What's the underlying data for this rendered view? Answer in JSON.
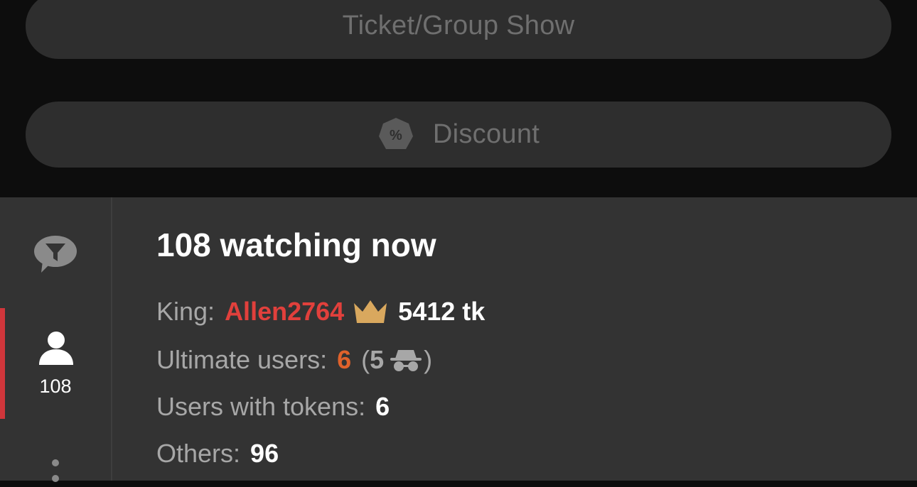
{
  "top_buttons": {
    "ticket_label": "Ticket/Group Show",
    "discount_label": "Discount"
  },
  "sidebar": {
    "chat_icon": "chat-filter-icon",
    "users_icon": "user-icon",
    "users_count": "108",
    "more_icon": "more-vertical-icon"
  },
  "viewers": {
    "title": "108 watching now",
    "king_label": "King:",
    "king_name": "Allen2764",
    "king_tokens": "5412 tk",
    "ultimate_label": "Ultimate users:",
    "ultimate_count": "6",
    "ultimate_open": "(",
    "ultimate_incognito_count": "5",
    "ultimate_close": ")",
    "tokens_label": "Users with tokens:",
    "tokens_count": "6",
    "others_label": "Others:",
    "others_count": "96"
  },
  "colors": {
    "accent_red": "#d0363b",
    "king_name": "#e1403c",
    "ultimate_count": "#e0622b",
    "crown": "#d9a85e"
  }
}
